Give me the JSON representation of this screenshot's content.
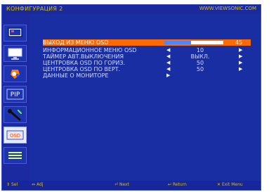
{
  "header": {
    "title": "КОНФИГУРАЦИЯ 2",
    "site": "WWW.VIEWSONIC.COM"
  },
  "sidebar": {
    "items": [
      {
        "name": "picture-tab"
      },
      {
        "name": "screen-tab"
      },
      {
        "name": "color-tab"
      },
      {
        "name": "pip-tab",
        "label": "PIP"
      },
      {
        "name": "setup-tab"
      },
      {
        "name": "osd-tab",
        "label": "OSD"
      },
      {
        "name": "config-tab"
      }
    ]
  },
  "menu": {
    "items": [
      {
        "label": "ВЫХОД ИЗ МЕНЮ OSD",
        "value": "45",
        "progress_percent": 45,
        "selected": true
      },
      {
        "label": "ИНФОРМАЦИОННОЕ МЕНЮ OSD",
        "value": "10",
        "selected": false
      },
      {
        "label": "ТАЙМЕР АВТ.ВЫКЛЮЧЕНИЯ",
        "value": "ВЫКЛ.",
        "selected": false
      },
      {
        "label": "ЦЕНТРОВКА OSD ПО ГОРИЗ.",
        "value": "50",
        "selected": false
      },
      {
        "label": "ЦЕНТРОВКА OSD ПО ВЕРТ.",
        "value": "50",
        "selected": false
      },
      {
        "label": "ДАННЫЕ О МОНИТОРЕ",
        "value": "",
        "selected": false
      }
    ]
  },
  "footer": {
    "hints": [
      {
        "key": "sel",
        "text": "Sel"
      },
      {
        "key": "adj",
        "text": "Adj"
      },
      {
        "key": "next",
        "text": "Next"
      },
      {
        "key": "return",
        "text": "Return"
      },
      {
        "key": "exit",
        "text": "Exit Menu"
      }
    ]
  },
  "colors": {
    "background": "#1b2aa0",
    "accent": "#ff6a00",
    "header_text": "#d9c000",
    "menu_text": "#d5dbff"
  }
}
